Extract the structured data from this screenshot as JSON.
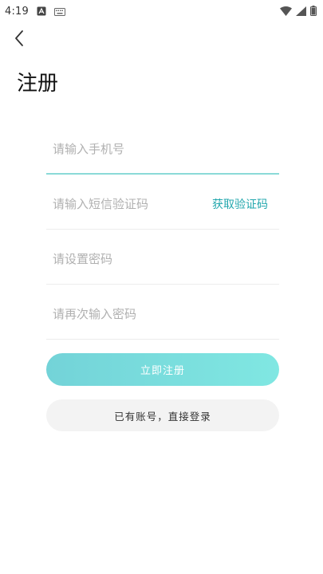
{
  "status_bar": {
    "time": "4:19",
    "icons": [
      "notification-a-icon",
      "keyboard-icon",
      "wifi-icon",
      "signal-icon",
      "battery-icon"
    ]
  },
  "header": {
    "back_icon": "chevron-left-icon",
    "title": "注册"
  },
  "form": {
    "phone": {
      "value": "",
      "placeholder": "请输入手机号"
    },
    "sms_code": {
      "value": "",
      "placeholder": "请输入短信验证码",
      "get_code_label": "获取验证码"
    },
    "password": {
      "value": "",
      "placeholder": "请设置密码"
    },
    "confirm_password": {
      "value": "",
      "placeholder": "请再次输入密码"
    }
  },
  "actions": {
    "register_label": "立即注册",
    "login_label": "已有账号，直接登录"
  },
  "colors": {
    "accent": "#22a7ad",
    "active_underline": "#8bdad8",
    "button_gradient_start": "#73d3d8",
    "button_gradient_end": "#80e7e2",
    "secondary_button_bg": "#f3f3f3"
  }
}
